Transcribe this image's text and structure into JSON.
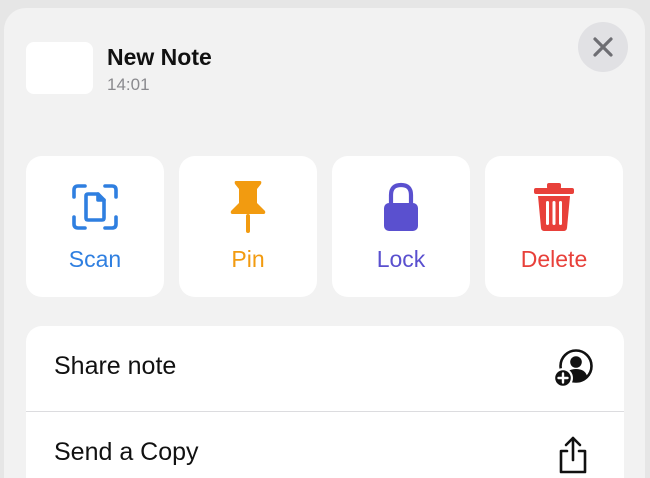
{
  "note": {
    "title": "New Note",
    "time": "14:01"
  },
  "actions": [
    {
      "label": "Scan",
      "icon": "scan-document-icon",
      "color": "#2f7fe0"
    },
    {
      "label": "Pin",
      "icon": "pin-icon",
      "color": "#f29b10"
    },
    {
      "label": "Lock",
      "icon": "lock-icon",
      "color": "#5a50cf"
    },
    {
      "label": "Delete",
      "icon": "trash-icon",
      "color": "#e8403a"
    }
  ],
  "menu": [
    {
      "label": "Share note",
      "icon": "add-person-icon"
    },
    {
      "label": "Send a Copy",
      "icon": "share-icon"
    }
  ]
}
